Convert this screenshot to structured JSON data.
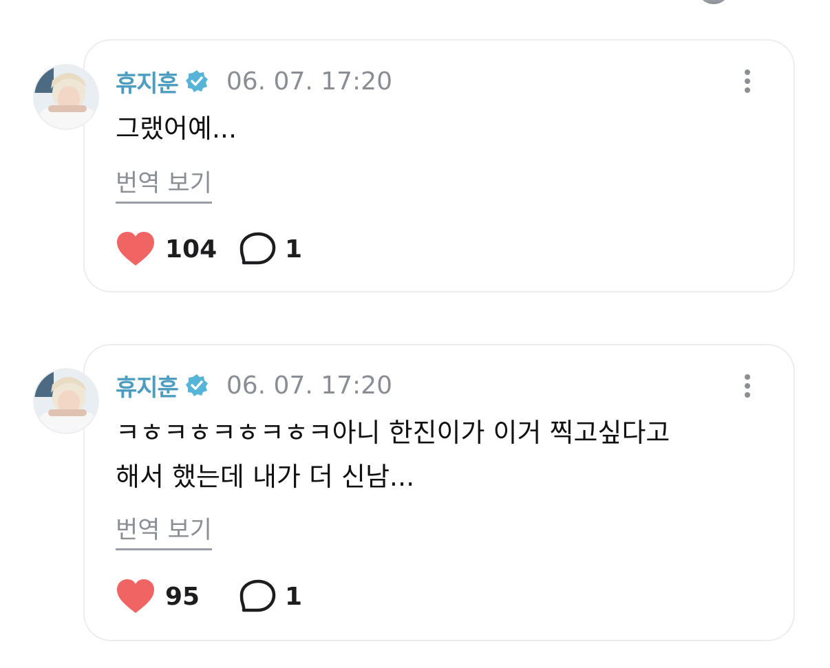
{
  "comments": [
    {
      "author": "휴지훈",
      "verified_icon": "verified-badge-icon",
      "timestamp": "06. 07. 17:20",
      "body": "그랬어예...",
      "translate_label": "번역 보기",
      "likes": "104",
      "replies": "1"
    },
    {
      "author": "휴지훈",
      "verified_icon": "verified-badge-icon",
      "timestamp": "06. 07. 17:20",
      "body": "ㅋㅎㅋㅎㅋㅎㅋㅎㅋ아니 한진이가 이거 찍고싶다고\n해서 했는데 내가 더 신남...",
      "translate_label": "번역 보기",
      "likes": "95",
      "replies": "1"
    }
  ],
  "colors": {
    "author": "#4d9dc0",
    "verified_badge": "#56b4d9",
    "heart": "#f06464",
    "muted_text": "#8a8d93",
    "card_border": "#ededf1"
  },
  "icons": {
    "like": "heart-icon",
    "reply": "speech-bubble-icon",
    "more": "more-vertical-icon"
  }
}
